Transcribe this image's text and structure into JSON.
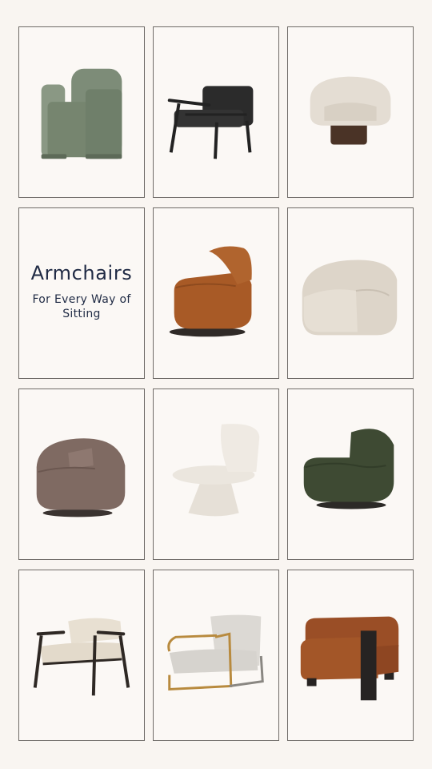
{
  "title": "Armchairs",
  "subtitle": "For Every Way of Sitting",
  "products": [
    {
      "icon": "green-upholstered-armchair-image",
      "color": "#7d8c78"
    },
    {
      "icon": "black-leather-lounge-chair-image",
      "color": "#2b2b2b"
    },
    {
      "icon": "cream-barrel-swivel-chair-image",
      "color": "#e4ddd3"
    },
    {
      "icon": "rust-boucle-swivel-chair-image",
      "color": "#a85a26"
    },
    {
      "icon": "oatmeal-boucle-barrel-chair-image",
      "color": "#ddd5c9"
    },
    {
      "icon": "taupe-boucle-swivel-chair-image",
      "color": "#7f6a62"
    },
    {
      "icon": "white-boucle-pedestal-chair-image",
      "color": "#ebe6de"
    },
    {
      "icon": "forest-green-boucle-swivel-chair-image",
      "color": "#3e4a33"
    },
    {
      "icon": "shearling-wood-frame-chair-image",
      "color": "#e8e0d2"
    },
    {
      "icon": "grey-boucle-brass-frame-chair-image",
      "color": "#d6d3ce"
    },
    {
      "icon": "rust-boucle-block-arm-chair-image",
      "color": "#9a4e26"
    }
  ]
}
